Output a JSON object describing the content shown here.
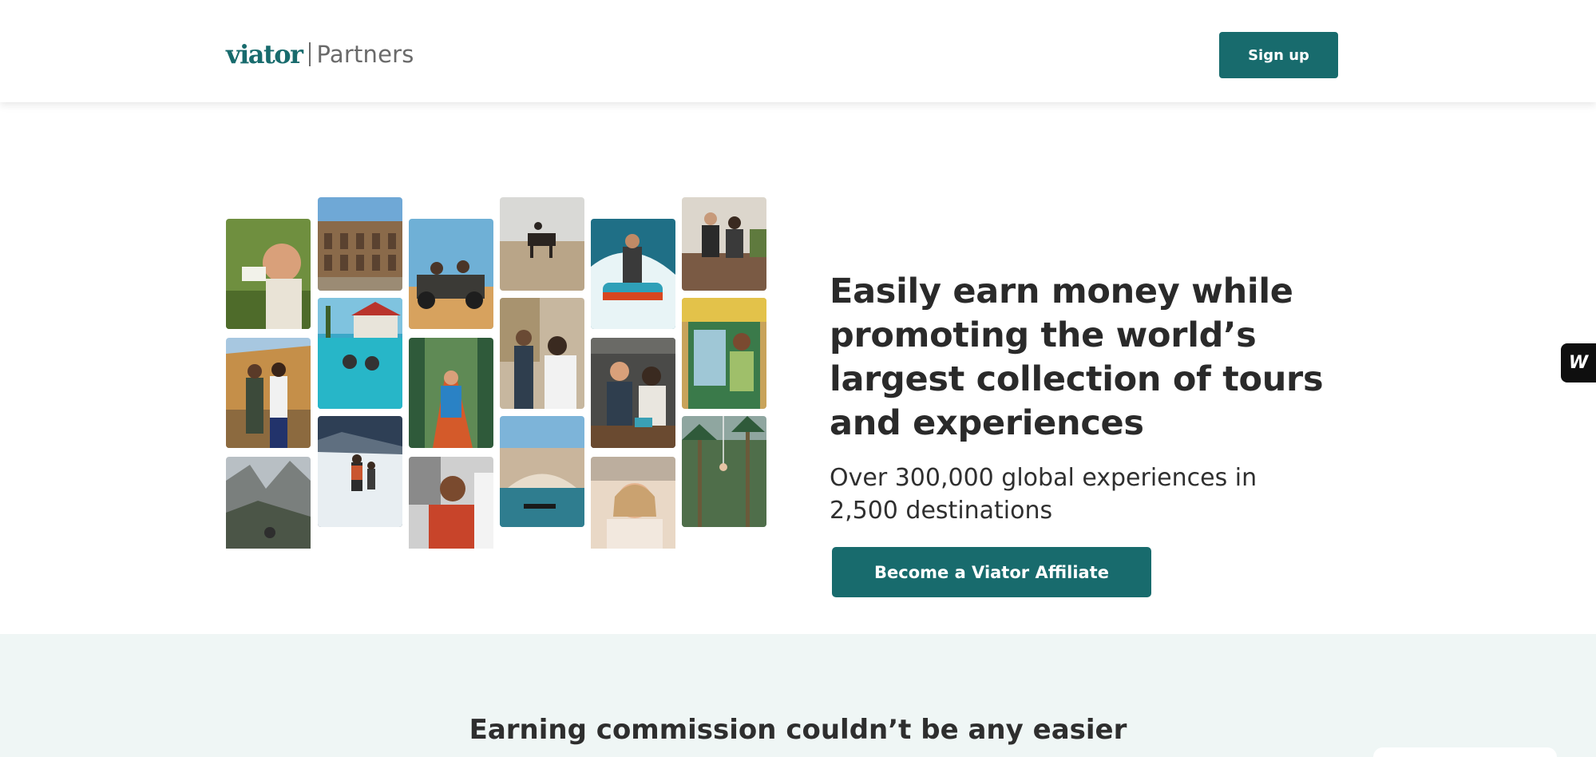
{
  "header": {
    "logo_word": "viator",
    "logo_sub": "Partners",
    "signup_label": "Sign up"
  },
  "hero": {
    "title": "Easily earn money while promoting the world’s largest collection of tours and experiences",
    "subtitle": "Over 300,000 global experiences in 2,500 destinations",
    "cta_label": "Become a Viator Affiliate"
  },
  "side_widget": {
    "label": "W"
  },
  "section2": {
    "title": "Earning commission couldn’t be any easier"
  },
  "colors": {
    "brand": "#186b6d",
    "section_bg": "#eff6f5"
  }
}
